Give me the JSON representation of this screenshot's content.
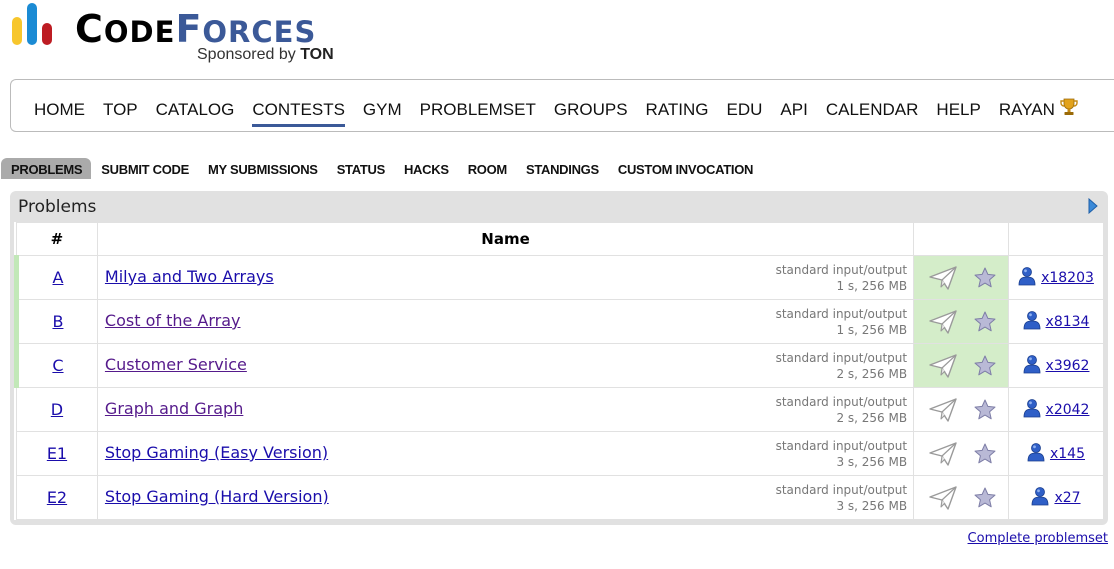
{
  "logo": {
    "word_c": "C",
    "word_ode": "ODE",
    "word_f": "F",
    "word_orces": "ORCES",
    "sponsor_prefix": "Sponsored by",
    "sponsor_name": "TON"
  },
  "menu": {
    "items": [
      "HOME",
      "TOP",
      "CATALOG",
      "CONTESTS",
      "GYM",
      "PROBLEMSET",
      "GROUPS",
      "RATING",
      "EDU",
      "API",
      "CALENDAR",
      "HELP",
      "RAYAN"
    ],
    "selected": "CONTESTS",
    "trophy_icon": "trophy-icon"
  },
  "submenu": {
    "items": [
      "PROBLEMS",
      "SUBMIT CODE",
      "MY SUBMISSIONS",
      "STATUS",
      "HACKS",
      "ROOM",
      "STANDINGS",
      "CUSTOM INVOCATION"
    ],
    "selected": "PROBLEMS"
  },
  "problems": {
    "title": "Problems",
    "col_index": "#",
    "col_name": "Name",
    "rows": [
      {
        "index": "A",
        "name": "Milya and Two Arrays",
        "io": "standard input/output",
        "limits": "1 s, 256 MB",
        "solved": "x18203",
        "accepted": true,
        "visited": false
      },
      {
        "index": "B",
        "name": "Cost of the Array",
        "io": "standard input/output",
        "limits": "1 s, 256 MB",
        "solved": "x8134",
        "accepted": true,
        "visited": true
      },
      {
        "index": "C",
        "name": "Customer Service",
        "io": "standard input/output",
        "limits": "2 s, 256 MB",
        "solved": "x3962",
        "accepted": true,
        "visited": true
      },
      {
        "index": "D",
        "name": "Graph and Graph",
        "io": "standard input/output",
        "limits": "2 s, 256 MB",
        "solved": "x2042",
        "accepted": false,
        "visited": true
      },
      {
        "index": "E1",
        "name": "Stop Gaming (Easy Version)",
        "io": "standard input/output",
        "limits": "3 s, 256 MB",
        "solved": "x145",
        "accepted": false,
        "visited": false
      },
      {
        "index": "E2",
        "name": "Stop Gaming (Hard Version)",
        "io": "standard input/output",
        "limits": "3 s, 256 MB",
        "solved": "x27",
        "accepted": false,
        "visited": false
      }
    ],
    "complete_link": "Complete problemset"
  },
  "colors": {
    "brand_blue": "#3b5998",
    "accepted_bg": "#d4edc9",
    "accepted_stripe": "#c2e8b8",
    "link": "#1a0dab",
    "visited_link": "#551a8b"
  }
}
